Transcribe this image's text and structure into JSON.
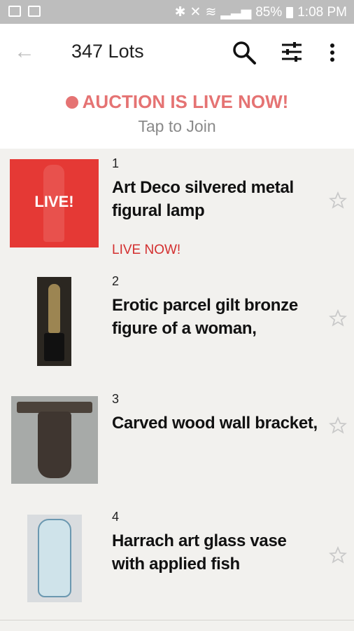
{
  "status_bar": {
    "battery": "85%",
    "time": "1:08 PM"
  },
  "app_bar": {
    "title": "347 Lots"
  },
  "banner": {
    "live_text": "AUCTION IS LIVE NOW!",
    "tap_text": "Tap to Join"
  },
  "lots": [
    {
      "number": "1",
      "title": "Art Deco silvered metal figural lamp",
      "badge": "LIVE!",
      "status": "LIVE NOW!"
    },
    {
      "number": "2",
      "title": "Erotic parcel gilt bronze figure of a woman,"
    },
    {
      "number": "3",
      "title": "Carved wood wall bracket,"
    },
    {
      "number": "4",
      "title": "Harrach art glass vase with applied fish"
    }
  ],
  "colors": {
    "accent_live": "#e57373",
    "live_red": "#d32f2f"
  }
}
